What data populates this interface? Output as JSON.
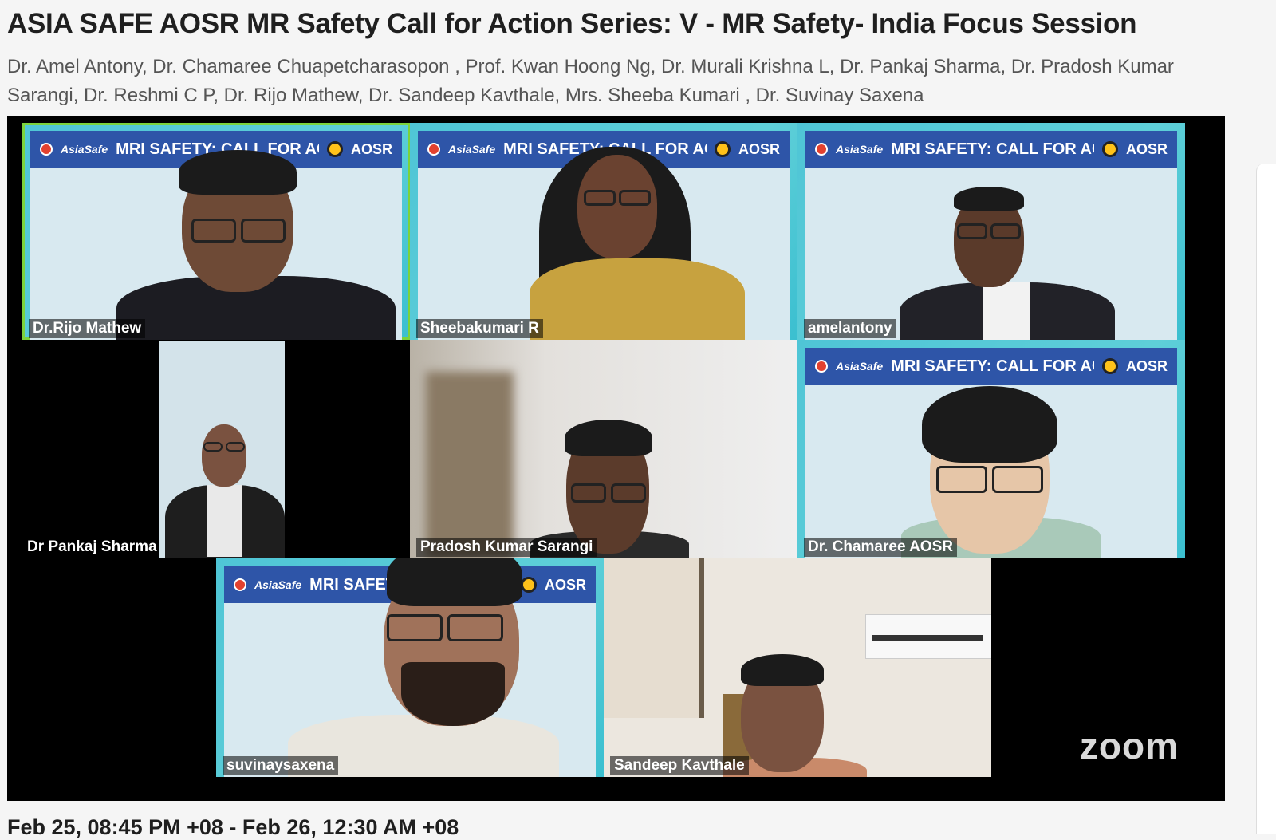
{
  "event": {
    "title": "ASIA SAFE AOSR MR Safety Call for Action Series: V - MR Safety- India Focus Session",
    "authors": "Dr. Amel Antony, Dr. Chamaree Chuapetcharasopon , Prof. Kwan Hoong Ng, Dr. Murali Krishna L, Dr. Pankaj Sharma, Dr. Pradosh Kumar Sarangi, Dr. Reshmi C P, Dr. Rijo Mathew, Dr. Sandeep Kavthale, Mrs. Sheeba Kumari , Dr. Suvinay Saxena",
    "datetime": "Feb 25, 08:45 PM +08 - Feb 26, 12:30 AM +08"
  },
  "banner": {
    "brand": "AsiaSafe",
    "headline": "MRI SAFETY: CALL FOR ACTION",
    "headline_cut": "MRI SAFETY:",
    "org": "AOSR"
  },
  "participants": [
    {
      "name": "Dr.Rijo Mathew",
      "speaking": true
    },
    {
      "name": "Sheebakumari R"
    },
    {
      "name": "amelantony"
    },
    {
      "name": "Dr Pankaj Sharma"
    },
    {
      "name": "Pradosh Kumar Sarangi"
    },
    {
      "name": "Dr. Chamaree AOSR"
    },
    {
      "name": "suvinaysaxena"
    },
    {
      "name": "Sandeep Kavthale"
    }
  ],
  "video": {
    "watermark": "zoom",
    "active_speaker_color": "#7cd33b"
  }
}
